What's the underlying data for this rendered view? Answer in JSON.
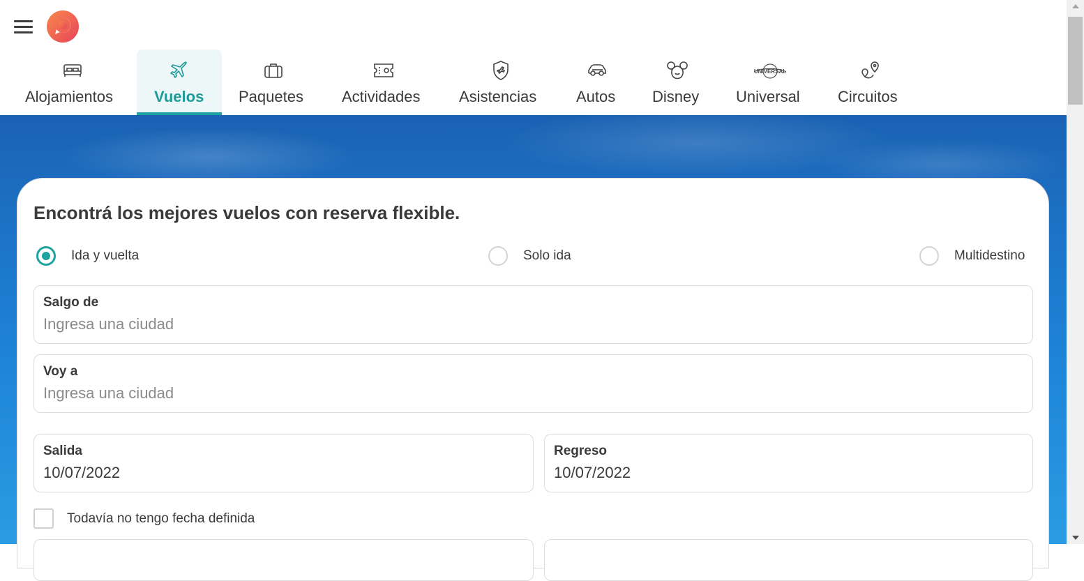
{
  "header": {
    "menu_icon": "hamburger-menu-icon",
    "logo_icon": "brand-logo-icon"
  },
  "tabs": [
    {
      "label": "Alojamientos",
      "icon": "bed-icon",
      "active": false
    },
    {
      "label": "Vuelos",
      "icon": "airplane-icon",
      "active": true
    },
    {
      "label": "Paquetes",
      "icon": "suitcase-icon",
      "active": false
    },
    {
      "label": "Actividades",
      "icon": "ticket-icon",
      "active": false
    },
    {
      "label": "Asistencias",
      "icon": "shield-plane-icon",
      "active": false
    },
    {
      "label": "Autos",
      "icon": "car-icon",
      "active": false
    },
    {
      "label": "Disney",
      "icon": "mickey-icon",
      "active": false
    },
    {
      "label": "Universal",
      "icon": "universal-globe-icon",
      "active": false
    },
    {
      "label": "Circuitos",
      "icon": "route-pins-icon",
      "active": false
    }
  ],
  "search": {
    "title": "Encontrá los mejores vuelos con reserva flexible.",
    "trip_types": [
      {
        "label": "Ida y vuelta",
        "checked": true
      },
      {
        "label": "Solo ida",
        "checked": false
      },
      {
        "label": "Multidestino",
        "checked": false
      }
    ],
    "origin": {
      "label": "Salgo de",
      "placeholder": "Ingresa una ciudad"
    },
    "destination": {
      "label": "Voy a",
      "placeholder": "Ingresa una ciudad"
    },
    "departure": {
      "label": "Salida",
      "value": "10/07/2022"
    },
    "return": {
      "label": "Regreso",
      "value": "10/07/2022"
    },
    "no_date_checkbox": {
      "label": "Todavía no tengo fecha definida",
      "checked": false
    }
  },
  "colors": {
    "accent": "#1ea3a0",
    "logo_orange": "#f26b3a",
    "logo_red": "#e8435a",
    "hero_blue": "#1c74c8"
  }
}
